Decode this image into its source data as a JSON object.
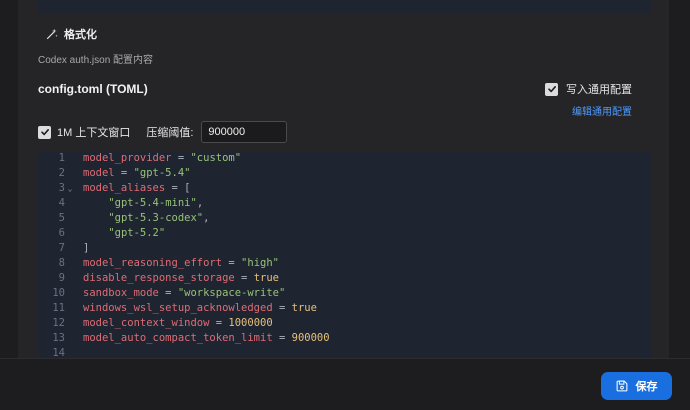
{
  "format_label": "格式化",
  "auth_hint": "Codex auth.json 配置内容",
  "section_title": "config.toml (TOML)",
  "write_common": {
    "label": "写入通用配置",
    "checked": true
  },
  "edit_common_link": "编辑通用配置",
  "context": {
    "checkbox_label": "1M 上下文窗口",
    "checked": true,
    "threshold_label": "压缩阈值:",
    "threshold_value": "900000"
  },
  "editor_lines": [
    {
      "n": "1",
      "fold": "",
      "parts": [
        [
          "k",
          "model_provider"
        ],
        [
          "o",
          " = "
        ],
        [
          "s",
          "\"custom\""
        ]
      ]
    },
    {
      "n": "2",
      "fold": "",
      "parts": [
        [
          "k",
          "model"
        ],
        [
          "o",
          " = "
        ],
        [
          "s",
          "\"gpt-5.4\""
        ]
      ]
    },
    {
      "n": "3",
      "fold": "⌄",
      "parts": [
        [
          "k",
          "model_aliases"
        ],
        [
          "o",
          " = ["
        ]
      ]
    },
    {
      "n": "4",
      "fold": "",
      "parts": [
        [
          "o",
          "    "
        ],
        [
          "s",
          "\"gpt-5.4-mini\""
        ],
        [
          "o",
          ","
        ]
      ]
    },
    {
      "n": "5",
      "fold": "",
      "parts": [
        [
          "o",
          "    "
        ],
        [
          "s",
          "\"gpt-5.3-codex\""
        ],
        [
          "o",
          ","
        ]
      ]
    },
    {
      "n": "6",
      "fold": "",
      "parts": [
        [
          "o",
          "    "
        ],
        [
          "s",
          "\"gpt-5.2\""
        ]
      ]
    },
    {
      "n": "7",
      "fold": "",
      "parts": [
        [
          "o",
          "]"
        ]
      ]
    },
    {
      "n": "8",
      "fold": "",
      "parts": [
        [
          "k",
          "model_reasoning_effort"
        ],
        [
          "o",
          " = "
        ],
        [
          "s",
          "\"high\""
        ]
      ]
    },
    {
      "n": "9",
      "fold": "",
      "parts": [
        [
          "k",
          "disable_response_storage"
        ],
        [
          "o",
          " = "
        ],
        [
          "n",
          "true"
        ]
      ]
    },
    {
      "n": "10",
      "fold": "",
      "parts": [
        [
          "k",
          "sandbox_mode"
        ],
        [
          "o",
          " = "
        ],
        [
          "s",
          "\"workspace-write\""
        ]
      ]
    },
    {
      "n": "11",
      "fold": "",
      "parts": [
        [
          "k",
          "windows_wsl_setup_acknowledged"
        ],
        [
          "o",
          " = "
        ],
        [
          "n",
          "true"
        ]
      ]
    },
    {
      "n": "12",
      "fold": "",
      "parts": [
        [
          "k",
          "model_context_window"
        ],
        [
          "o",
          " = "
        ],
        [
          "n",
          "1000000"
        ]
      ]
    },
    {
      "n": "13",
      "fold": "",
      "parts": [
        [
          "k",
          "model_auto_compact_token_limit"
        ],
        [
          "o",
          " = "
        ],
        [
          "n",
          "900000"
        ]
      ]
    },
    {
      "n": "14",
      "fold": "",
      "parts": []
    }
  ],
  "save_label": "保存",
  "icons": {
    "format": "magic-wand-icon",
    "save": "floppy-disk-icon",
    "checkbox": "checkmark-icon"
  }
}
